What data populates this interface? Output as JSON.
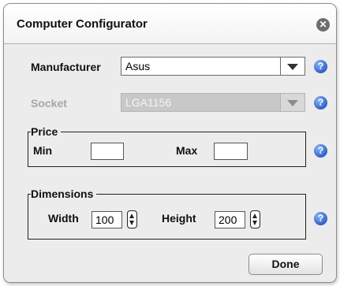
{
  "window": {
    "title": "Computer Configurator",
    "close_glyph": "✕"
  },
  "manufacturer": {
    "label": "Manufacturer",
    "selected": "Asus",
    "enabled": true
  },
  "socket": {
    "label": "Socket",
    "selected": "LGA1156",
    "enabled": false
  },
  "price": {
    "legend": "Price",
    "min_label": "Min",
    "min_value": "",
    "max_label": "Max",
    "max_value": ""
  },
  "dimensions": {
    "legend": "Dimensions",
    "width_label": "Width",
    "width_value": "100",
    "height_label": "Height",
    "height_value": "200"
  },
  "help_glyph": "?",
  "done_label": "Done",
  "icons": {
    "close": "close-icon",
    "help": "help-icon",
    "dropdown": "chevron-down-icon",
    "stepper": "stepper-icon"
  },
  "colors": {
    "help_blue": "#2d63c8",
    "disabled_gray": "#c8c8c8",
    "dialog_body": "#ececec"
  }
}
